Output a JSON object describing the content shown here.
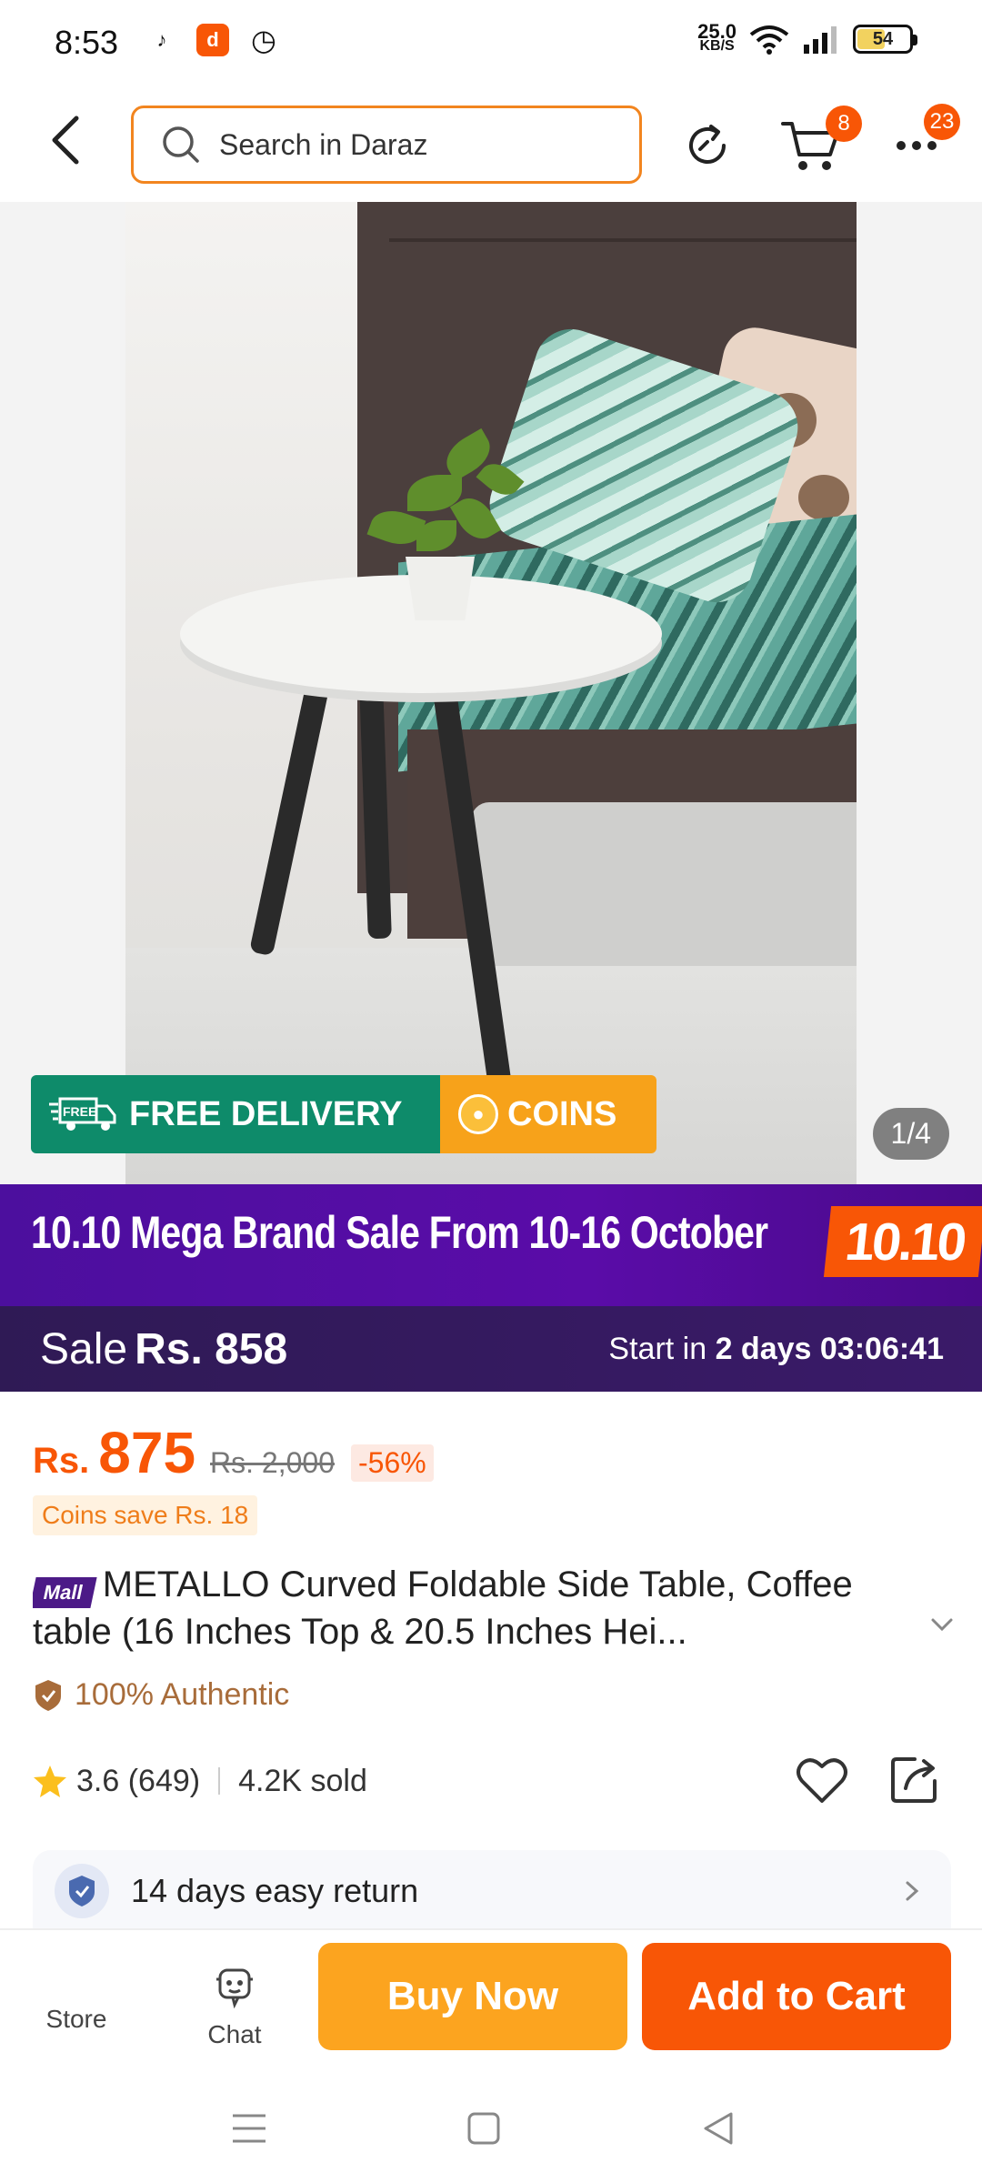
{
  "status_bar": {
    "time": "8:53",
    "net_speed_value": "25.0",
    "net_speed_unit": "KB/S",
    "battery": "54",
    "battery_level": 0.54
  },
  "header": {
    "search_placeholder": "Search in Daraz",
    "cart_count": "8",
    "more_count": "23"
  },
  "gallery": {
    "free_delivery": "FREE DELIVERY",
    "free_truck_text": "FREE",
    "coins": "COINS",
    "pager": "1/4"
  },
  "banner": {
    "text": "10.10 Mega Brand Sale From 10-16 October",
    "logo": "10.10"
  },
  "sale": {
    "label": "Sale",
    "price": "Rs. 858",
    "start_prefix": "Start in",
    "days": "2 days",
    "countdown": "03:06:41"
  },
  "price": {
    "currency": "Rs.",
    "value": "875",
    "original": "Rs. 2,000",
    "discount": "-56%",
    "coins_save": "Coins save Rs. 18"
  },
  "product": {
    "mall_tag": "Mall",
    "title": "METALLO Curved Foldable Side Table, Coffee table (16 Inches Top & 20.5 Inches Hei...",
    "authentic": "100% Authentic",
    "rating": "3.6 (649)",
    "sold": "4.2K sold",
    "return_policy": "14 days easy return"
  },
  "bottom_bar": {
    "store": "Store",
    "chat": "Chat",
    "buy_now": "Buy Now",
    "add_to_cart": "Add to Cart"
  },
  "colors": {
    "brand_orange": "#f85606",
    "buy_now": "#fca41f",
    "banner_purple": "#4c0f9e",
    "free_delivery_green": "#0e8b6a"
  }
}
